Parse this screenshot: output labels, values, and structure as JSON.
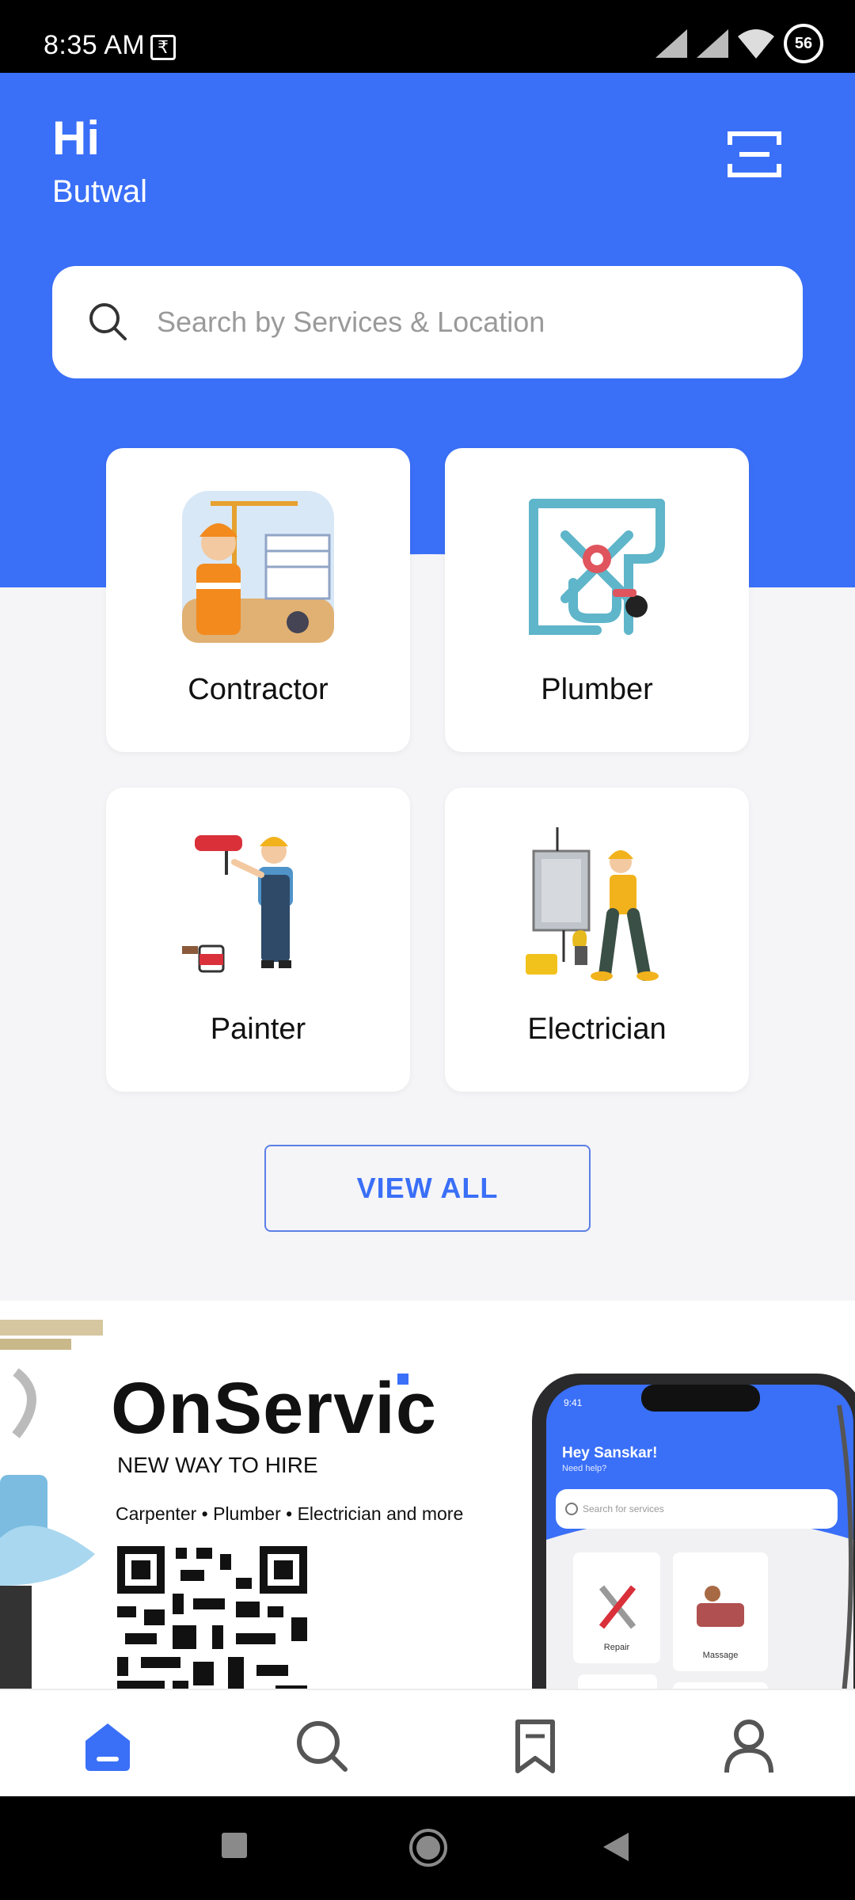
{
  "status": {
    "time": "8:35 AM",
    "rupee": "₹",
    "battery": "56"
  },
  "header": {
    "hi": "Hi",
    "location": "Butwal"
  },
  "search": {
    "placeholder": "Search by Services & Location"
  },
  "categories": [
    {
      "label": "Contractor",
      "icon": "contractor-illustration"
    },
    {
      "label": "Plumber",
      "icon": "plumber-pipes-illustration"
    },
    {
      "label": "Painter",
      "icon": "painter-illustration"
    },
    {
      "label": "Electrician",
      "icon": "electrician-illustration"
    }
  ],
  "view_all": "VIEW ALL",
  "banner": {
    "brand": "OnServic",
    "tagline": "NEW WAY TO HIRE",
    "services": "Carpenter • Plumber • Electrician and more",
    "phone": {
      "time": "9:41",
      "greeting": "Hey Sanskar!",
      "subtext": "Need help?",
      "search": "Search for services",
      "tile1": "Repair",
      "tile2": "Massage"
    }
  },
  "nav": [
    "home-icon",
    "search-icon",
    "bookmark-icon",
    "profile-icon"
  ],
  "colors": {
    "primary": "#3a6ff7",
    "background": "#f5f5f7"
  }
}
